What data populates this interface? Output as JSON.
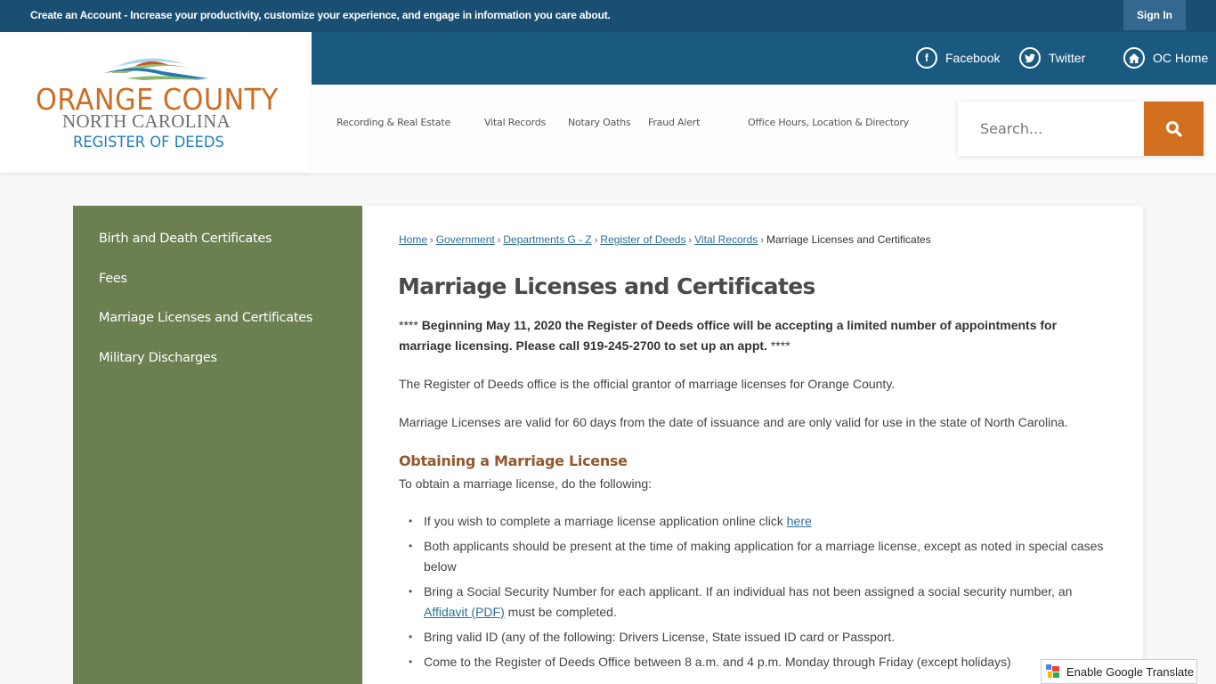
{
  "topbar": {
    "create_account": "Create an Account - Increase your productivity, customize your experience, and engage in information you care about.",
    "sign_in": "Sign In"
  },
  "social": [
    {
      "label": "Facebook",
      "icon": "facebook-icon"
    },
    {
      "label": "Twitter",
      "icon": "twitter-icon"
    },
    {
      "label": "OC Home",
      "icon": "home-icon"
    }
  ],
  "logo": {
    "line1": "ORANGE COUNTY",
    "line2": "NORTH CAROLINA",
    "line3": "REGISTER OF DEEDS"
  },
  "nav": [
    {
      "label": "Recording & Real Estate"
    },
    {
      "label": "Vital Records"
    },
    {
      "label": "Notary Oaths"
    },
    {
      "label": "Fraud Alert"
    },
    {
      "label": "Office Hours, Location & Directory"
    }
  ],
  "search": {
    "placeholder": "Search..."
  },
  "sidebar": {
    "items": [
      {
        "label": "Birth and Death Certificates"
      },
      {
        "label": "Fees"
      },
      {
        "label": "Marriage Licenses and Certificates"
      },
      {
        "label": "Military Discharges"
      }
    ]
  },
  "breadcrumb": {
    "links": [
      "Home",
      "Government",
      "Departments G - Z",
      "Register of Deeds",
      "Vital Records"
    ],
    "current": "Marriage Licenses and Certificates",
    "separator": "›"
  },
  "main": {
    "title": "Marriage Licenses and Certificates",
    "notice_prefix": "****",
    "notice": "Beginning May 11, 2020 the Register of Deeds office will be accepting a limited number of appointments for marriage licensing. Please call 919-245-2700 to set up an appt.",
    "notice_suffix": "****",
    "para1": "The Register of Deeds office is the official grantor of marriage licenses for Orange County.",
    "para2": "Marriage Licenses are valid for 60 days from the date of issuance and are only valid for use in the state of North Carolina.",
    "subheading": "Obtaining a Marriage License",
    "intro": "To obtain a marriage license, do the following:",
    "list": {
      "item1_text": "If you wish to complete a marriage license application online click ",
      "item1_link": "here",
      "item2": "Both applicants should be present at the time of making application for a marriage license, except as noted in special cases below",
      "item3_text": "Bring a Social Security Number for each applicant. If an individual has not been assigned a social security number, an ",
      "item3_link": "Affidavit (PDF)",
      "item3_tail": " must be completed.",
      "item4": "Bring valid ID (any of the following: Drivers License, State issued ID card or Passport.",
      "item5": "Come to the Register of Deeds Office between 8 a.m. and 4 p.m. Monday through Friday (except holidays)"
    }
  },
  "translate": {
    "label": "Enable Google Translate"
  },
  "colors": {
    "topbar": "#1b4f72",
    "header_band": "#1b5a80",
    "accent_orange": "#d2701f",
    "sidebar_green": "#6b7f51",
    "link_blue": "#2f6f95",
    "subheading_brown": "#93582d"
  }
}
